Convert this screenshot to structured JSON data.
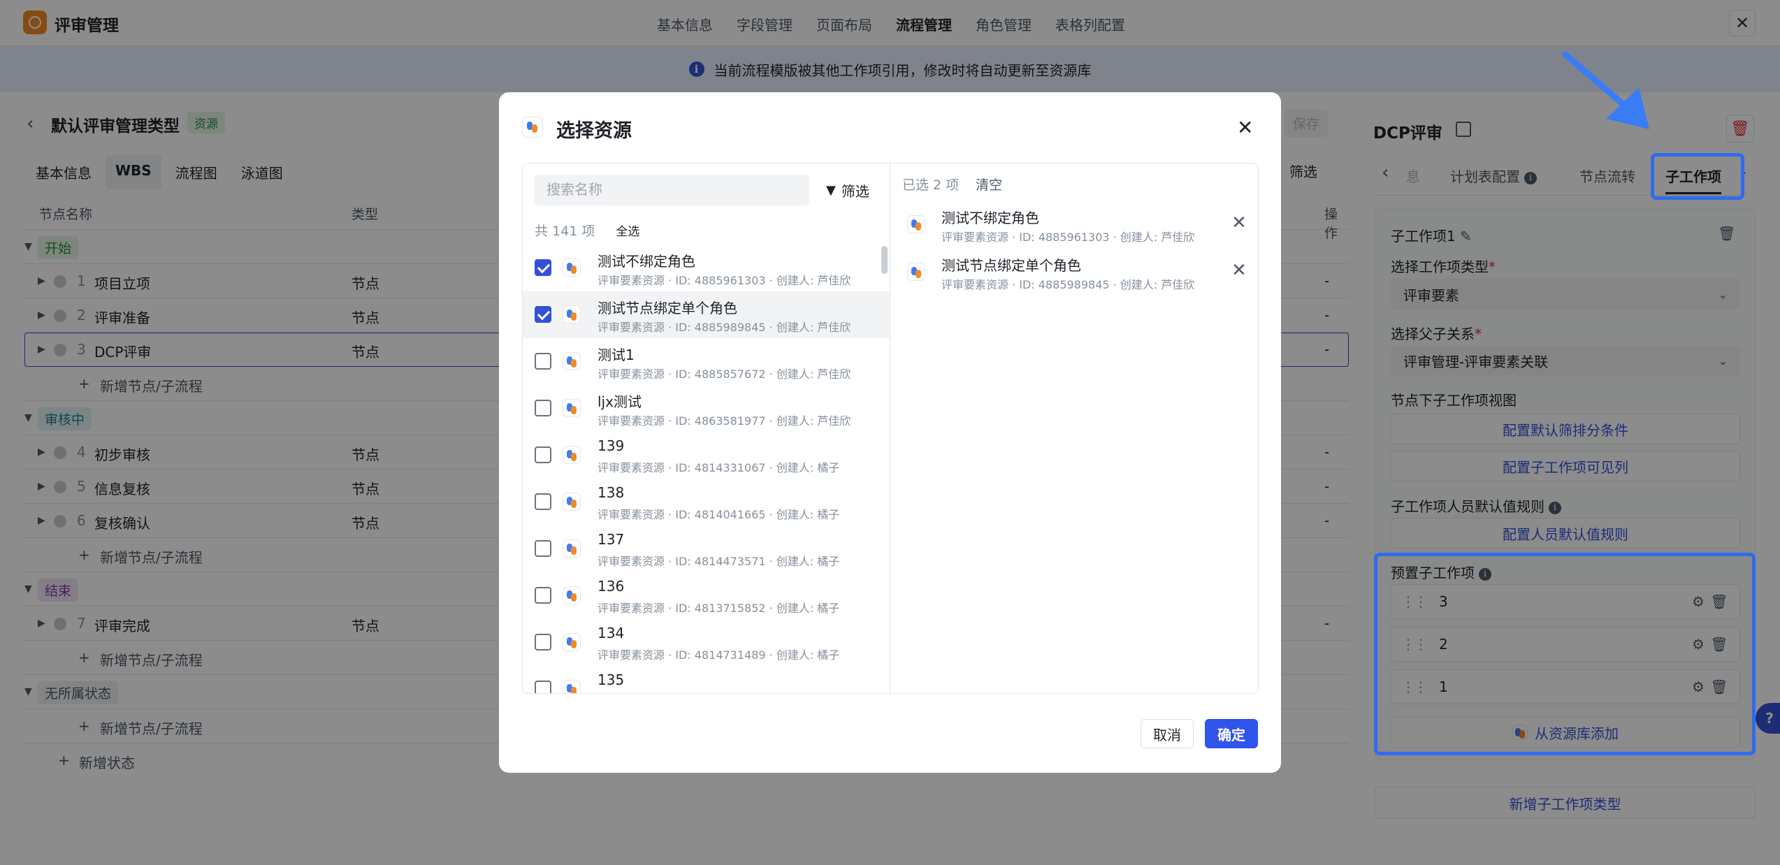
{
  "app": {
    "title": "评审管理",
    "close": "✕"
  },
  "top_nav": [
    "基本信息",
    "字段管理",
    "页面布局",
    "流程管理",
    "角色管理",
    "表格列配置"
  ],
  "info_bar": {
    "icon": "i",
    "text": "当前流程模版被其他工作项引用，修改时将自动更新至资源库"
  },
  "left_panel": {
    "title": "默认评审管理类型",
    "tag": "资源",
    "save": "保存",
    "filter": "筛选",
    "tabs": [
      "基本信息",
      "WBS",
      "流程图",
      "泳道图"
    ],
    "columns": {
      "name": "节点名称",
      "type": "类型",
      "ops": "操作"
    },
    "rows": [
      {
        "kind": "group",
        "label": "开始",
        "color": "#e4f5e3",
        "text_color": "#2b8a3e"
      },
      {
        "kind": "node",
        "num": "1",
        "label": "项目立项",
        "type": "节点",
        "op": "-"
      },
      {
        "kind": "node",
        "num": "2",
        "label": "评审准备",
        "type": "节点",
        "op": "-"
      },
      {
        "kind": "node",
        "num": "3",
        "label": "DCP评审",
        "type": "节点",
        "op": "-"
      },
      {
        "kind": "add",
        "label": "新增节点/子流程"
      },
      {
        "kind": "group",
        "label": "审核中",
        "color": "#e3f3f6",
        "text_color": "#1a7f8e"
      },
      {
        "kind": "node",
        "num": "4",
        "label": "初步审核",
        "type": "节点",
        "op": "-"
      },
      {
        "kind": "node",
        "num": "5",
        "label": "信息复核",
        "type": "节点",
        "op": "-"
      },
      {
        "kind": "node",
        "num": "6",
        "label": "复核确认",
        "type": "节点",
        "op": "-"
      },
      {
        "kind": "add",
        "label": "新增节点/子流程"
      },
      {
        "kind": "group",
        "label": "结束",
        "color": "#f1e6f7",
        "text_color": "#8a3ba8"
      },
      {
        "kind": "node",
        "num": "7",
        "label": "评审完成",
        "type": "节点",
        "op": "-"
      },
      {
        "kind": "add",
        "label": "新增节点/子流程"
      },
      {
        "kind": "group",
        "label": "无所属状态",
        "color": "#eef0f3",
        "text_color": "#4e5969"
      },
      {
        "kind": "add",
        "label": "新增节点/子流程"
      },
      {
        "kind": "add_state",
        "label": "新增状态"
      }
    ]
  },
  "right_panel": {
    "title": "DCP评审",
    "tabs": {
      "left_arrow": "‹",
      "cut": "息",
      "plan": "计划表配置",
      "flow": "节点流转",
      "sub": "子工作项",
      "right_arrow": "›"
    },
    "sub_item_name": "子工作项1",
    "type_label": "选择工作项类型",
    "type_value": "评审要素",
    "relation_label": "选择父子关系",
    "relation_value": "评审管理-评审要素关联",
    "view_label": "节点下子工作项视图",
    "btn_filter": "配置默认筛排分条件",
    "btn_visible": "配置子工作项可见列",
    "default_label": "子工作项人员默认值规则",
    "btn_default": "配置人员默认值规则",
    "preset_label": "预置子工作项",
    "presets": [
      "3",
      "2",
      "1"
    ],
    "add_from_lib": "从资源库添加",
    "add_type": "新增子工作项类型",
    "help": "?"
  },
  "modal": {
    "title": "选择资源",
    "search_placeholder": "搜索名称",
    "filter": "筛选",
    "total": "共 141 项",
    "select_all": "全选",
    "items": [
      {
        "name": "测试不绑定角色",
        "sub": "评审要素资源 · ID: 4885961303 · 创建人: 芦佳欣",
        "checked": true
      },
      {
        "name": "测试节点绑定单个角色",
        "sub": "评审要素资源 · ID: 4885989845 · 创建人: 芦佳欣",
        "checked": true,
        "hover": true
      },
      {
        "name": "测试1",
        "sub": "评审要素资源 · ID: 4885857672 · 创建人: 芦佳欣",
        "checked": false
      },
      {
        "name": "ljx测试",
        "sub": "评审要素资源 · ID: 4863581977 · 创建人: 芦佳欣",
        "checked": false
      },
      {
        "name": "139",
        "sub": "评审要素资源 · ID: 4814331067 · 创建人: 橘子",
        "checked": false
      },
      {
        "name": "138",
        "sub": "评审要素资源 · ID: 4814041665 · 创建人: 橘子",
        "checked": false
      },
      {
        "name": "137",
        "sub": "评审要素资源 · ID: 4814473571 · 创建人: 橘子",
        "checked": false
      },
      {
        "name": "136",
        "sub": "评审要素资源 · ID: 4813715852 · 创建人: 橘子",
        "checked": false
      },
      {
        "name": "134",
        "sub": "评审要素资源 · ID: 4814731489 · 创建人: 橘子",
        "checked": false
      },
      {
        "name": "135",
        "sub": "",
        "checked": false
      }
    ],
    "selected_count": "已选 2 项",
    "clear": "清空",
    "selected": [
      {
        "name": "测试不绑定角色",
        "sub": "评审要素资源 · ID: 4885961303 · 创建人: 芦佳欣"
      },
      {
        "name": "测试节点绑定单个角色",
        "sub": "评审要素资源 · ID: 4885989845 · 创建人: 芦佳欣"
      }
    ],
    "cancel": "取消",
    "confirm": "确定",
    "close": "✕"
  },
  "colors": {
    "primary": "#2f54eb",
    "annotation": "#2e6bf0",
    "logo": "#f08a24"
  }
}
